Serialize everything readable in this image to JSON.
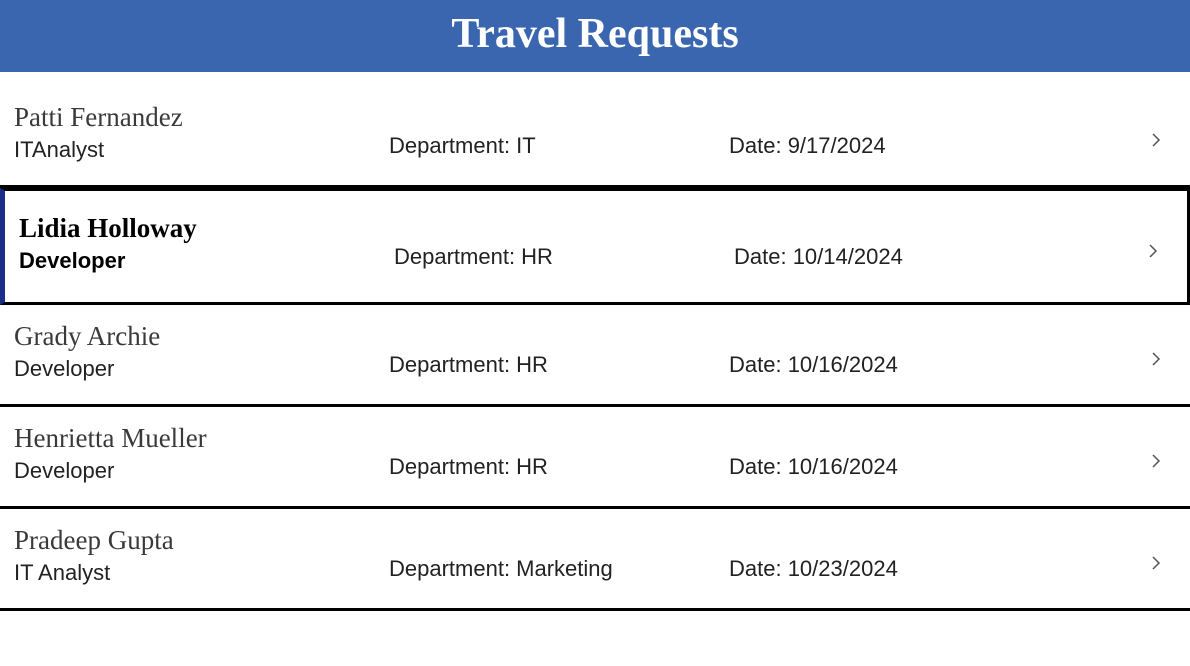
{
  "header": {
    "title": "Travel Requests"
  },
  "labels": {
    "department_prefix": "Department: ",
    "date_prefix": "Date: "
  },
  "rows": [
    {
      "name": "Patti Fernandez",
      "role": "ITAnalyst",
      "department": "IT",
      "date": "9/17/2024",
      "selected": false
    },
    {
      "name": "Lidia Holloway",
      "role": "Developer",
      "department": "HR",
      "date": "10/14/2024",
      "selected": true
    },
    {
      "name": "Grady Archie",
      "role": "Developer",
      "department": "HR",
      "date": "10/16/2024",
      "selected": false
    },
    {
      "name": "Henrietta Mueller",
      "role": "Developer",
      "department": "HR",
      "date": "10/16/2024",
      "selected": false
    },
    {
      "name": "Pradeep Gupta",
      "role": "IT Analyst",
      "department": "Marketing",
      "date": "10/23/2024",
      "selected": false
    }
  ]
}
